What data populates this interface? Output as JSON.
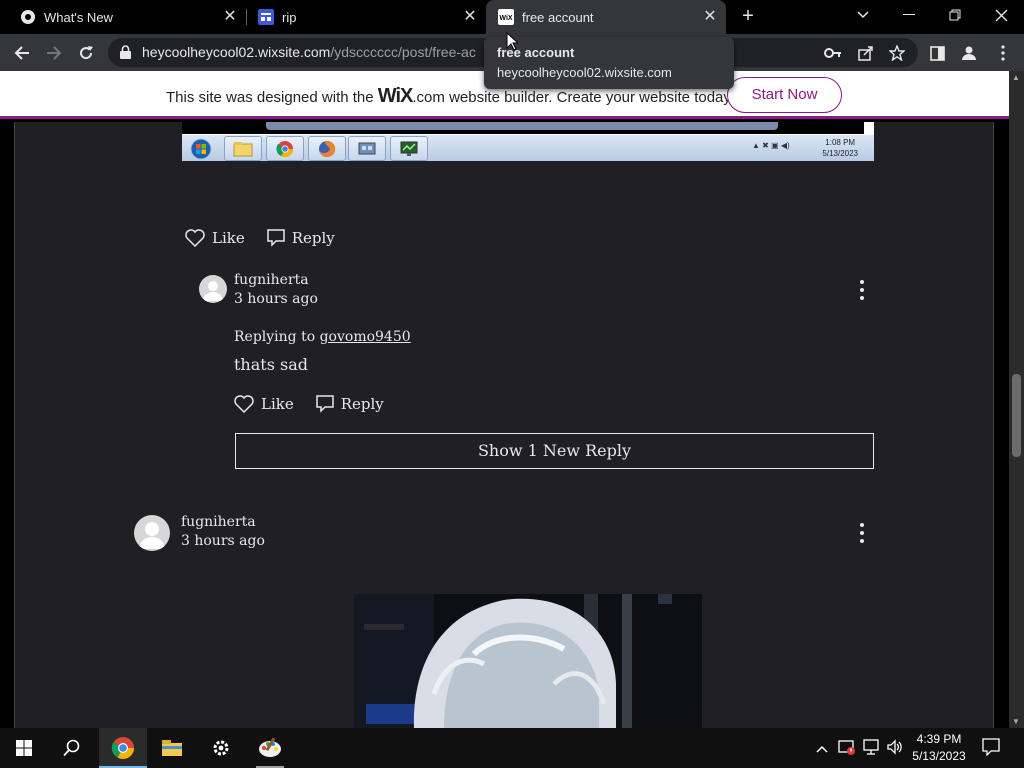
{
  "browser": {
    "tabs": [
      {
        "title": "What's New",
        "icon": "chrome-icon"
      },
      {
        "title": "rip",
        "icon": "wix-blog-icon"
      },
      {
        "title": "free account",
        "icon": "wix-icon",
        "active": true
      }
    ],
    "url": {
      "domain": "heycoolheycool02.wixsite.com",
      "path": "/ydscccccc/post/free-ac"
    },
    "tooltip": {
      "title": "free account",
      "url": "heycoolheycool02.wixsite.com"
    }
  },
  "wix_banner": {
    "text_before": "This site was designed with the ",
    "logo": "WiX",
    "text_after": ".com website builder. Create your website today.",
    "button": "Start Now",
    "accent": "#8a1a85"
  },
  "embedded_screenshot": {
    "clock_time": "1:08 PM",
    "clock_date": "5/13/2023"
  },
  "post_actions": {
    "like": "Like",
    "reply": "Reply"
  },
  "reply_comment": {
    "author": "fugniherta",
    "time": "3 hours ago",
    "replying_label": "Replying to ",
    "replying_to": "govomo9450",
    "text": "thats sad",
    "like": "Like",
    "reply": "Reply",
    "show_replies": "Show 1 New Reply"
  },
  "second_comment": {
    "author": "fugniherta",
    "time": "3 hours ago"
  },
  "taskbar": {
    "clock_time": "4:39 PM",
    "clock_date": "5/13/2023",
    "apps": [
      "windows-start-icon",
      "search-icon",
      "chrome-icon",
      "file-explorer-icon",
      "settings-icon",
      "paint-icon"
    ]
  }
}
